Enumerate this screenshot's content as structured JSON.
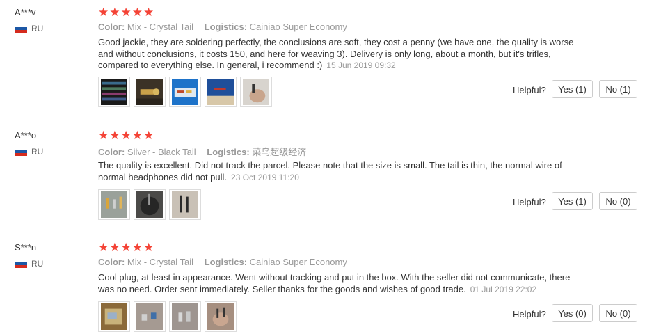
{
  "reviews": [
    {
      "user": "A***v",
      "country": "RU",
      "stars": 5,
      "color_label": "Color:",
      "color_value": "Mix - Crystal Tail",
      "logistics_label": "Logistics:",
      "logistics_value": "Cainiao Super Economy",
      "text": "Good jackie, they are soldering perfectly, the conclusions are soft, they cost a penny (we have one, the quality is worse and without conclusions, it costs 150, and here for weaving 3). Delivery is only long, about a month, but it's trifles, compared to everything else. In general, i recommend :)",
      "date": "15 Jun 2019 09:32",
      "helpful_label": "Helpful?",
      "yes_label": "Yes (1)",
      "no_label": "No (1)"
    },
    {
      "user": "A***o",
      "country": "RU",
      "stars": 5,
      "color_label": "Color:",
      "color_value": "Silver - Black Tail",
      "logistics_label": "Logistics:",
      "logistics_value": "菜鸟超级经济",
      "text": "The quality is excellent. Did not track the parcel. Please note that the size is small. The tail is thin, the normal wire of normal headphones did not pull.",
      "date": "23 Oct 2019 11:20",
      "helpful_label": "Helpful?",
      "yes_label": "Yes (1)",
      "no_label": "No (0)"
    },
    {
      "user": "S***n",
      "country": "RU",
      "stars": 5,
      "color_label": "Color:",
      "color_value": "Mix - Crystal Tail",
      "logistics_label": "Logistics:",
      "logistics_value": "Cainiao Super Economy",
      "text": "Cool plug, at least in appearance. Went without tracking and put in the box. With the seller did not communicate, there was no need. Order sent immediately. Seller thanks for the goods and wishes of good trade.",
      "date": "01 Jul 2019 22:02",
      "helpful_label": "Helpful?",
      "yes_label": "Yes (0)",
      "no_label": "No (0)"
    }
  ],
  "colors": {
    "star": "#f44336",
    "muted": "#999999",
    "text": "#333333",
    "flag_white": "#ffffff",
    "flag_blue": "#1c57a5",
    "flag_red": "#d52b1e"
  },
  "icons": {
    "star": "star-icon",
    "flag": "russia-flag-icon"
  }
}
